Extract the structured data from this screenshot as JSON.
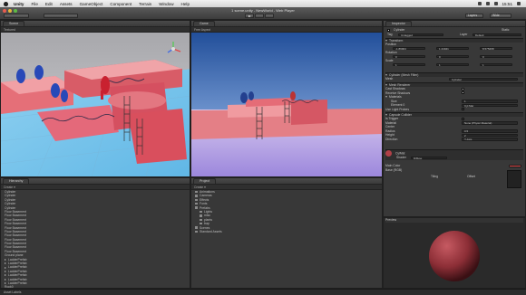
{
  "menubar": {
    "items": [
      "Unity",
      "File",
      "Edit",
      "Assets",
      "GameObject",
      "Component",
      "Terrain",
      "Window",
      "Help"
    ],
    "time": "15:51"
  },
  "window": {
    "title": "1 scene.unity - NewWorld - Web Player"
  },
  "toolbar": {
    "layers": "Layers",
    "layout": "Wide"
  },
  "scene": {
    "tab": "Scene",
    "draw_mode": "Textured"
  },
  "game": {
    "tab": "Game",
    "aspect": "Free Aspect"
  },
  "hierarchy": {
    "tab": "Hierarchy",
    "items": [
      "Cylinder",
      "Cylinder",
      "Cylinder",
      "Cylinder",
      "Cylinder",
      "Floor Basement",
      "Floor Basement",
      "Floor Basement",
      "Floor Basement",
      "Floor Basement",
      "Floor Basement",
      "Floor Basement",
      "Floor Basement",
      "Floor Basement",
      "Floor Basement",
      "Floor Basement",
      "Ground plane",
      "LadderPrefab",
      "LadderPrefab",
      "LadderPrefab",
      "LadderPrefab",
      "LadderPrefab",
      "LadderPrefab",
      "LadderPrefab",
      "Rock0",
      "Rock1"
    ]
  },
  "project": {
    "tab": "Project",
    "items": [
      {
        "label": "Animations",
        "indent": 0
      },
      {
        "label": "Cameras",
        "indent": 0
      },
      {
        "label": "Effects",
        "indent": 0
      },
      {
        "label": "Fonts",
        "indent": 0
      },
      {
        "label": "Prefabs",
        "indent": 0
      },
      {
        "label": "Lights",
        "indent": 1
      },
      {
        "label": "misc",
        "indent": 1
      },
      {
        "label": "plants",
        "indent": 1
      },
      {
        "label": "trap",
        "indent": 1
      },
      {
        "label": "Scenes",
        "indent": 0
      },
      {
        "label": "Standard Assets",
        "indent": 0
      }
    ]
  },
  "inspector": {
    "tab": "Inspector",
    "object_name": "Cylinder",
    "static_label": "Static",
    "tag_label": "Tag",
    "tag_value": "Untagged",
    "layer_label": "Layer",
    "layer_value": "Default",
    "transform": "Transform",
    "position_label": "Position",
    "position": {
      "x": "-1.89904",
      "y": "1.44941",
      "z": "8.575268"
    },
    "rotation_label": "Rotation",
    "rotation": {
      "x": "0",
      "y": "0",
      "z": "0"
    },
    "scale_label": "Scale",
    "scale": {
      "x": "1",
      "y": "1",
      "z": "1"
    },
    "mesh_filter": "Cylinder (Mesh Filter)",
    "mesh_label": "Mesh",
    "mesh_value": "Cylinder",
    "mesh_renderer": "Mesh Renderer",
    "cast_shadows": "Cast Shadows",
    "receive_shadows": "Receive Shadows",
    "materials": "Materials",
    "size_label": "Size",
    "size_value": "1",
    "element_label": "Element 0",
    "element_value": "Cyl.Mat",
    "light_probes": "Use Light Probes",
    "collider": "Capsule Collider",
    "is_trigger": "Is Trigger",
    "material_label": "Material",
    "material_value": "None (Physic Material)",
    "center_label": "Center",
    "radius_label": "Radius",
    "radius_value": "0.5",
    "height_label": "Height",
    "height_value": "2",
    "direction_label": "Direction",
    "direction_value": "Y-Axis",
    "shader_material": "CylMat",
    "shader_label": "Shader",
    "shader_value": "Diffuse",
    "main_color": "Main Color",
    "base_rgb": "Base (RGB)",
    "tiling": "Tiling",
    "offset": "Offset",
    "preview": "Preview"
  },
  "status": "Asset Labels"
}
